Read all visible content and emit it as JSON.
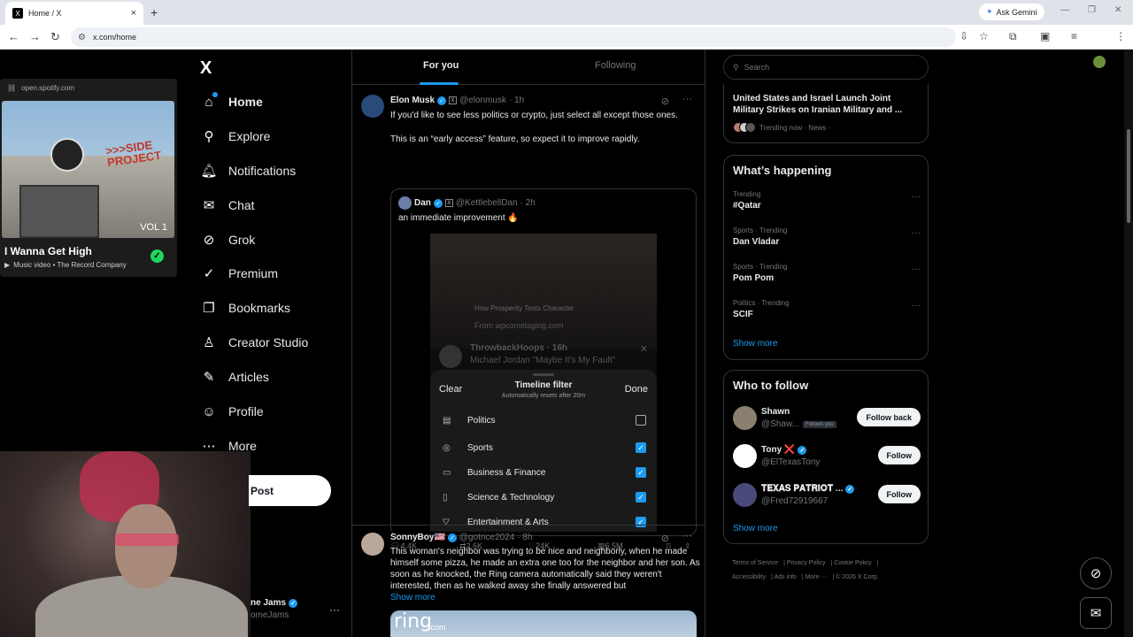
{
  "browser": {
    "tab_title": "Home / X",
    "tab_favicon": "X",
    "close": "×",
    "new_tab": "+",
    "gemini": "Ask Gemini",
    "url": "x.com/home"
  },
  "spotify": {
    "source": "open.spotify.com",
    "art_sign": ">>>SIDE PROJECT",
    "art_vol": "VOL 1",
    "title": "I Wanna Get High",
    "meta": "Music video • The Record Company"
  },
  "sidebar": {
    "logo": "X",
    "items": [
      {
        "label": "Home",
        "icon": "home-icon",
        "glyph": "⌂"
      },
      {
        "label": "Explore",
        "icon": "search-icon",
        "glyph": "⚲"
      },
      {
        "label": "Notifications",
        "icon": "bell-icon",
        "glyph": "♫"
      },
      {
        "label": "Chat",
        "icon": "mail-icon",
        "glyph": "✉"
      },
      {
        "label": "Grok",
        "icon": "grok-icon",
        "glyph": "⊘"
      },
      {
        "label": "Premium",
        "icon": "premium-icon",
        "glyph": "✓"
      },
      {
        "label": "Bookmarks",
        "icon": "bookmark-icon",
        "glyph": "❐"
      },
      {
        "label": "Creator Studio",
        "icon": "creator-icon",
        "glyph": "♙"
      },
      {
        "label": "Articles",
        "icon": "articles-icon",
        "glyph": "✎"
      },
      {
        "label": "Profile",
        "icon": "profile-icon",
        "glyph": "☺"
      },
      {
        "label": "More",
        "icon": "more-icon",
        "glyph": "⋯"
      }
    ],
    "post": "Post",
    "account_name": "ne Jams",
    "account_handle": "omeJams",
    "account_more": "···"
  },
  "timeline": {
    "tabs": [
      "For you",
      "Following"
    ],
    "tweet1": {
      "name": "Elon Musk",
      "handle": "@elonmusk",
      "time": "· 1h",
      "text1": "If you'd like to see less politics or crypto, just select all except those ones.",
      "text2": "This is an “early access” feature, so expect it to improve rapidly.",
      "quote": {
        "name": "Dan",
        "handle": "@KettlebellDan",
        "time": "· 2h",
        "text": "an immediate improvement 🔥",
        "shot_cap1": "How Prosperity Tests Character",
        "shot_cap2": "From wpcomstaging.com",
        "shot_user": "ThrowbackHoops",
        "shot_time": "· 16h",
        "shot_text": "Michael Jordan \"Maybe It's My Fault\"",
        "filter": {
          "clear": "Clear",
          "title": "Timeline filter",
          "subtitle": "Automatically resets after 20m",
          "done": "Done",
          "rows": [
            {
              "label": "Politics",
              "checked": false,
              "glyph": "▤"
            },
            {
              "label": "Sports",
              "checked": true,
              "glyph": "◎"
            },
            {
              "label": "Business & Finance",
              "checked": true,
              "glyph": "▭"
            },
            {
              "label": "Science & Technology",
              "checked": true,
              "glyph": "▯"
            },
            {
              "label": "Entertainment & Arts",
              "checked": true,
              "glyph": "▽"
            }
          ]
        }
      },
      "replies": "4.4K",
      "reposts": "2.6K",
      "likes": "24K",
      "views": "6.5M"
    },
    "tweet2": {
      "name": "SonnyBoy🇺🇸",
      "handle": "@gotrice2024",
      "time": "· 8h",
      "text": "This woman's neighbor was trying to be nice and neighborly, when he made himself some pizza, he made an extra one too for the neighbor and her son. As soon as he knocked, the Ring camera automatically said  they weren't interested, then as he walked away she finally answered but",
      "show_more": "Show more",
      "ring_logo": "ring",
      "ring_com": ".com"
    }
  },
  "right": {
    "search_placeholder": "Search",
    "news": {
      "headline": "United States and Israel Launch Joint Military Strikes on Iranian Military and ...",
      "meta": "Trending now · News ·"
    },
    "happening": {
      "title": "What’s happening",
      "trends": [
        {
          "context": "Trending",
          "name": "#Qatar"
        },
        {
          "context": "Sports · Trending",
          "name": "Dan Vladar"
        },
        {
          "context": "Sports · Trending",
          "name": "Pom Pom"
        },
        {
          "context": "Politics · Trending",
          "name": "SCIF"
        }
      ],
      "show_more": "Show more"
    },
    "who": {
      "title": "Who to follow",
      "people": [
        {
          "name": "Shawn",
          "handle": "@Shaw...",
          "follows_you": "Follows you",
          "button": "Follow back"
        },
        {
          "name": "Tony ❌",
          "handle": "@ElTexasTony",
          "button": "Follow"
        },
        {
          "name": "𝐓𝐄𝐗𝐀𝐒 𝐏𝐀𝐓𝐑𝐈𝐎𝐓 ...",
          "handle": "@Fred72919667",
          "button": "Follow"
        }
      ],
      "show_more": "Show more"
    },
    "footer": [
      "Terms of Service",
      "Privacy Policy",
      "Cookie Policy",
      "Accessibility",
      "Ads info",
      "More ···",
      "© 2026 X Corp."
    ]
  }
}
